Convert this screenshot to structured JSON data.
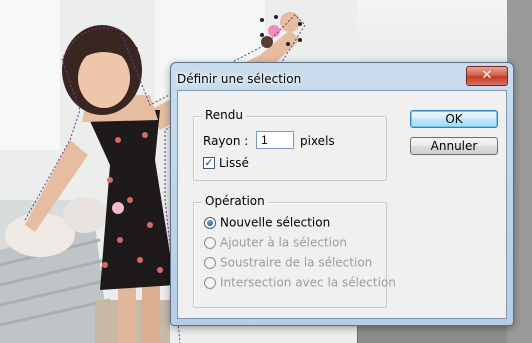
{
  "dialog": {
    "title": "Définir une sélection",
    "close_icon": "close-x-icon",
    "rendu": {
      "group_label": "Rendu",
      "radius_label": "Rayon :",
      "radius_value": "1",
      "radius_unit": "pixels",
      "smooth_label": "Lissé",
      "smooth_checked": true
    },
    "operation": {
      "group_label": "Opération",
      "options": [
        {
          "label": "Nouvelle sélection",
          "checked": true,
          "enabled": true
        },
        {
          "label": "Ajouter à la sélection",
          "checked": false,
          "enabled": false
        },
        {
          "label": "Soustraire de la sélection",
          "checked": false,
          "enabled": false
        },
        {
          "label": "Intersection avec la sélection",
          "checked": false,
          "enabled": false
        }
      ]
    },
    "buttons": {
      "ok_label": "OK",
      "cancel_label": "Annuler"
    }
  },
  "colors": {
    "title_bar": "#b7cde6",
    "close_button": "#c13a25",
    "default_button_border": "#3c7fb1",
    "disabled_text": "#9c9c9c"
  }
}
